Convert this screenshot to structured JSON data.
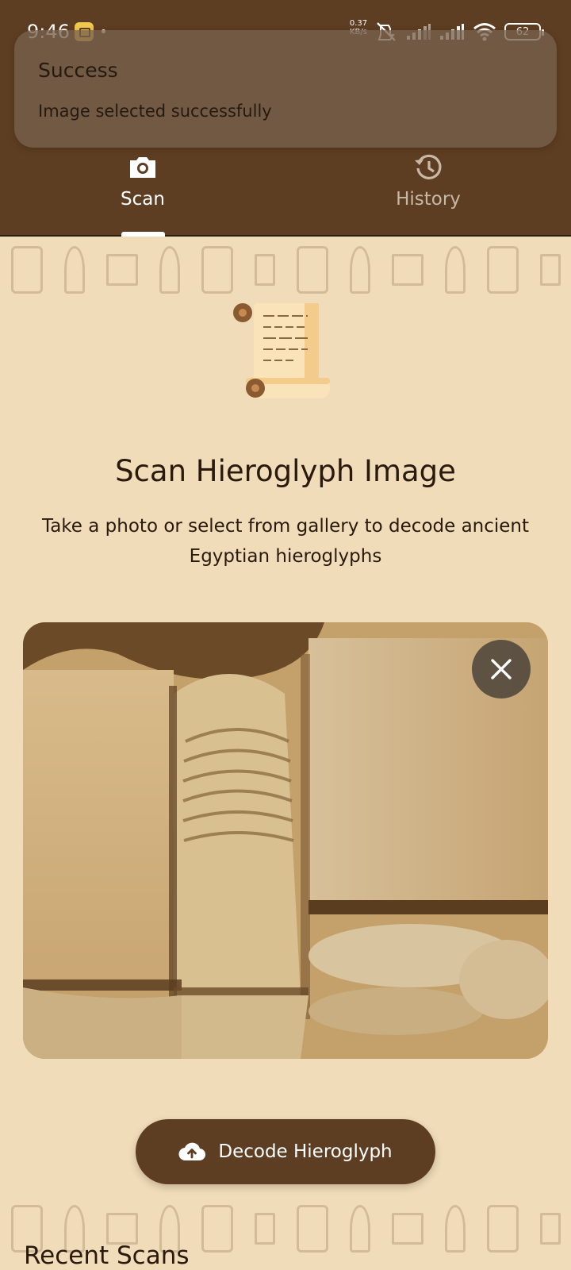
{
  "status_bar": {
    "time": "9:46",
    "speed_value": "0.37",
    "speed_unit": "KB/s",
    "battery": "62",
    "icons": [
      "app-notification-icon",
      "mute-vibrate-icon",
      "signal-icon",
      "signal-icon",
      "wifi-icon",
      "battery-icon"
    ]
  },
  "toast": {
    "title": "Success",
    "message": "Image selected successfully"
  },
  "tabs": [
    {
      "label": "Scan",
      "icon": "camera-icon",
      "selected": true
    },
    {
      "label": "History",
      "icon": "history-icon",
      "selected": false
    }
  ],
  "main": {
    "illustration": "scroll-icon",
    "title": "Scan Hieroglyph Image",
    "subtitle": "Take a photo or select from gallery to decode ancient Egyptian hieroglyphs",
    "decode_button": "Decode Hieroglyph",
    "recent_title": "Recent Scans"
  },
  "colors": {
    "primary": "#5e3e22",
    "background": "#f0dcb8",
    "text": "#2a1a0e",
    "toast": "#78624e"
  }
}
